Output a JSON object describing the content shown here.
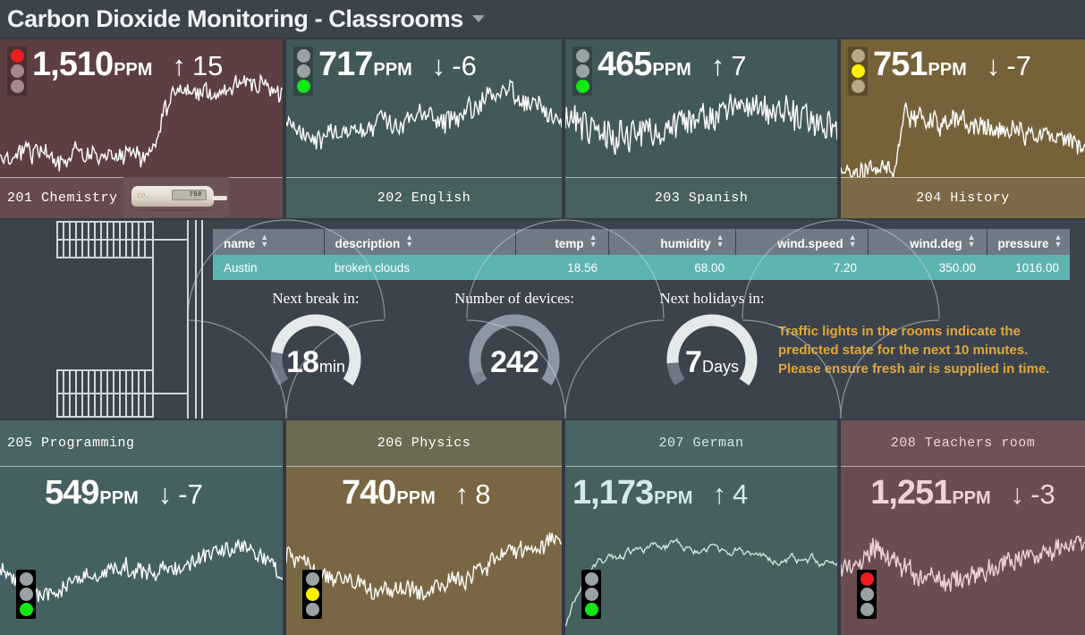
{
  "header": {
    "title": "Carbon Dioxide Monitoring - Classrooms",
    "caret": "chevron-down-icon"
  },
  "rooms_top": [
    {
      "room": "201 Chemistry",
      "value": "1,510",
      "unit": "PPM",
      "arrow": "↑",
      "delta": "15",
      "light": "red",
      "bg": "#5d3f42",
      "strip_bg": "#674a4d",
      "text": "#ffffff",
      "line": "#ffffff",
      "device_lcd": "750"
    },
    {
      "room": "202 English",
      "value": "717",
      "unit": "PPM",
      "arrow": "↓",
      "delta": "-6",
      "light": "green",
      "bg": "#42585b",
      "strip_bg": "#48605f",
      "text": "#ffffff",
      "line": "#ffffff"
    },
    {
      "room": "203 Spanish",
      "value": "465",
      "unit": "PPM",
      "arrow": "↑",
      "delta": "7",
      "light": "green",
      "bg": "#42585b",
      "strip_bg": "#48605f",
      "text": "#ffffff",
      "line": "#ffffff"
    },
    {
      "room": "204 History",
      "value": "751",
      "unit": "PPM",
      "arrow": "↓",
      "delta": "-7",
      "light": "yellow",
      "bg": "#756239",
      "strip_bg": "#7b6a45",
      "text": "#ffffff",
      "line": "#ffffff"
    }
  ],
  "rooms_bottom": [
    {
      "room": "205 Programming",
      "value": "549",
      "unit": "PPM",
      "arrow": "↓",
      "delta": "-7",
      "light": "green",
      "bg": "#456063",
      "strip_bg": "#4a6365",
      "text": "#ffffff",
      "line": "#ffffff"
    },
    {
      "room": "206 Physics",
      "value": "740",
      "unit": "PPM",
      "arrow": "↑",
      "delta": "8",
      "light": "yellow",
      "bg": "#796743",
      "strip_bg": "#6c6a53",
      "text": "#ffffff",
      "line": "#ffffff"
    },
    {
      "room": "207 German",
      "value": "1,173",
      "unit": "PPM",
      "arrow": "↑",
      "delta": "4",
      "light": "green",
      "bg": "#46605f",
      "strip_bg": "#4b6465",
      "text": "#d7e9ea",
      "line": "#cfe4e3"
    },
    {
      "room": "208 Teachers room",
      "value": "1,251",
      "unit": "PPM",
      "arrow": "↓",
      "delta": "-3",
      "light": "red",
      "bg": "#6b4d51",
      "strip_bg": "#6e5256",
      "text": "#f0d3d6",
      "line": "#f0d3d6"
    }
  ],
  "weather_table": {
    "columns": [
      {
        "label": "name",
        "align": "left"
      },
      {
        "label": "description",
        "align": "left"
      },
      {
        "label": "temp",
        "align": "right"
      },
      {
        "label": "humidity",
        "align": "right"
      },
      {
        "label": "wind.speed",
        "align": "right"
      },
      {
        "label": "wind.deg",
        "align": "right"
      },
      {
        "label": "pressure",
        "align": "right"
      }
    ],
    "rows": [
      {
        "name": "Austin",
        "description": "broken clouds",
        "temp": "18.56",
        "humidity": "68.00",
        "wind_speed": "7.20",
        "wind_deg": "350.00",
        "pressure": "1016.00"
      }
    ]
  },
  "gauges": [
    {
      "title": "Next break in:",
      "value": "18",
      "unit": "min",
      "arc_color": "#e4e9ec",
      "track_color": "#6d7883",
      "fraction": 0.82
    },
    {
      "title": "Number of devices:",
      "value": "242",
      "unit": "",
      "arc_color": "#8b97a1",
      "track_color": "#7d8892",
      "fraction": 0.94
    },
    {
      "title": "Next holidays in:",
      "value": "7",
      "unit": "Days",
      "arc_color": "#e4e9ec",
      "track_color": "#6d7883",
      "fraction": 0.88
    }
  ],
  "notice": {
    "text": "Traffic lights in the rooms indicate the predicted state for the next 10 minutes. Please ensure  fresh air is supplied in time.",
    "color": "#e2a73a"
  },
  "colors": {
    "page_bg": "#333a44",
    "panel_bg": "#3b434d",
    "table_header": "#6e7a84",
    "table_row": "#5eb5b0",
    "light_red": "#f01d1d",
    "light_yellow": "#fff200",
    "light_green": "#13e813"
  }
}
